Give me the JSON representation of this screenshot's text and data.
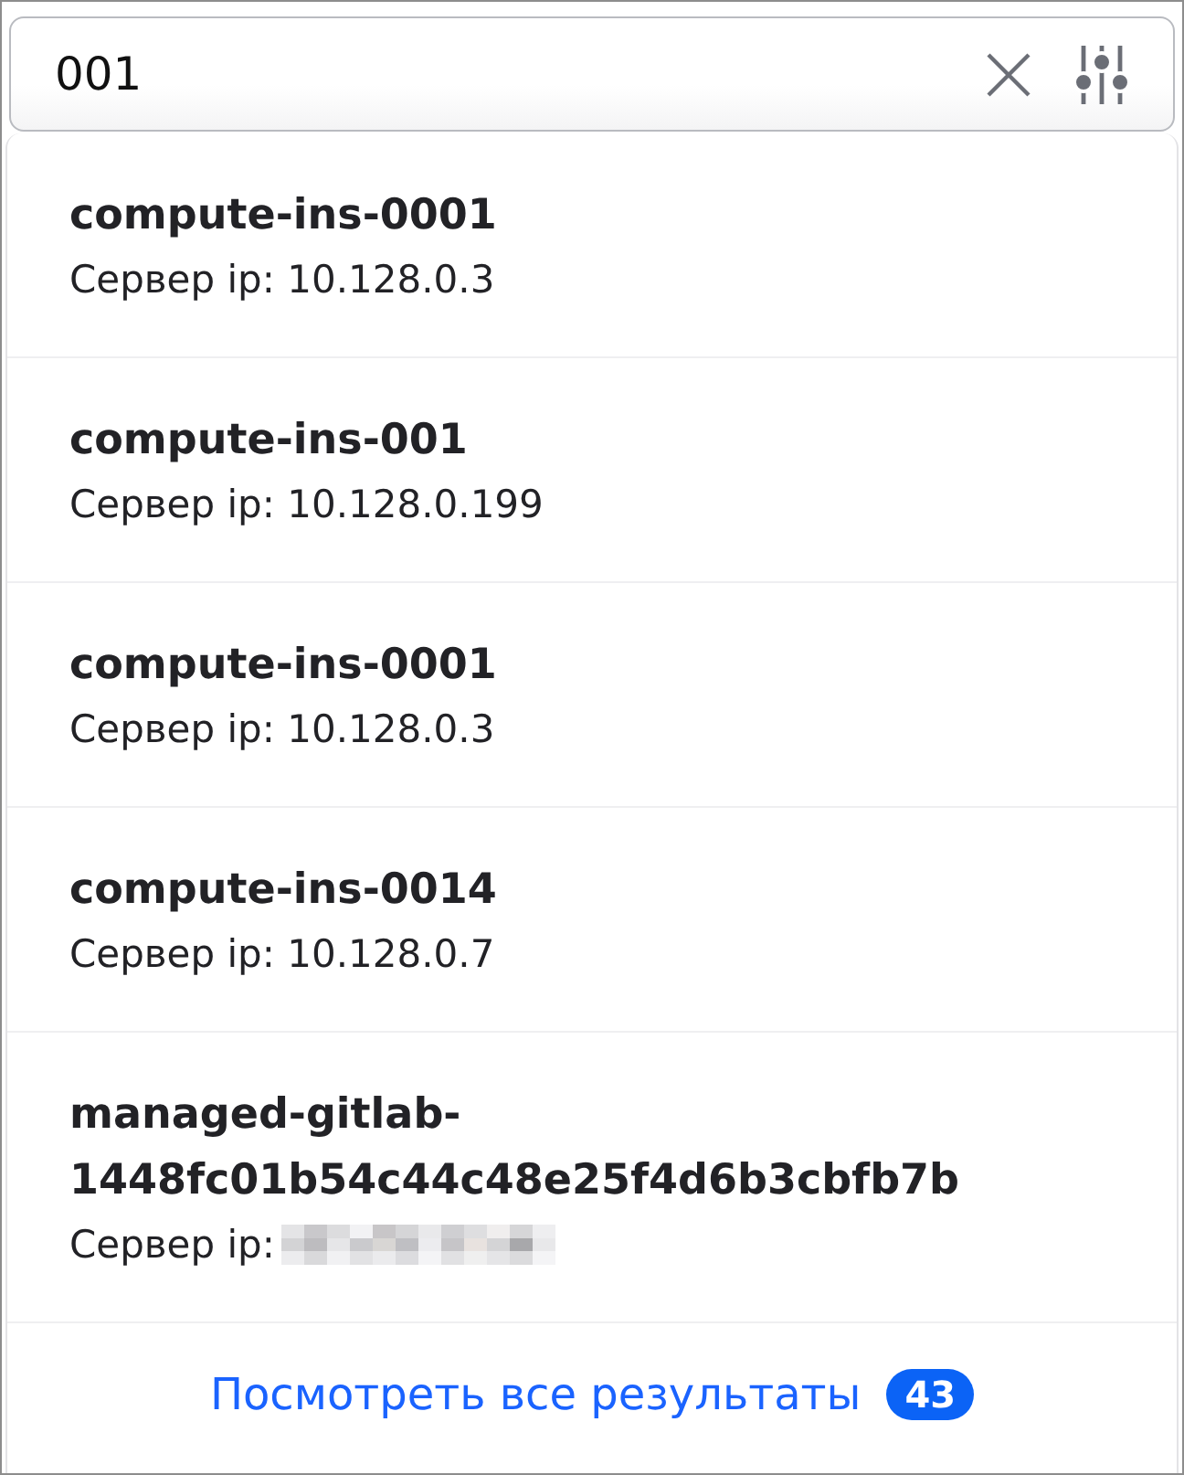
{
  "search": {
    "value": "001"
  },
  "results": [
    {
      "title": "compute-ins-0001",
      "subtitle": "Сервер ip: 10.128.0.3",
      "redacted": false
    },
    {
      "title": "compute-ins-001",
      "subtitle": "Сервер ip: 10.128.0.199",
      "redacted": false
    },
    {
      "title": "compute-ins-0001",
      "subtitle": "Сервер ip: 10.128.0.3",
      "redacted": false
    },
    {
      "title": "compute-ins-0014",
      "subtitle": "Сервер ip: 10.128.0.7",
      "redacted": false
    },
    {
      "title": "managed-gitlab-1448fc01b54c44c48e25f4d6b3cbfb7b",
      "subtitle": "Сервер ip:",
      "redacted": true
    }
  ],
  "footer": {
    "link": "Посмотреть все результаты",
    "count": "43"
  }
}
